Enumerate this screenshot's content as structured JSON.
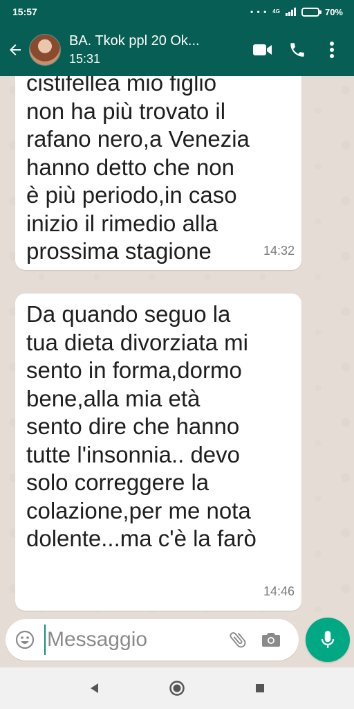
{
  "status_bar": {
    "time": "15:57",
    "dots": "• • •",
    "network": "4G",
    "battery_percent": "70%",
    "battery_level": 0.7
  },
  "header": {
    "contact_name": "BA. Tkok ppl 20 Ok...",
    "subtitle": "15:31",
    "icons": [
      "back-arrow-icon",
      "video-call-icon",
      "phone-icon",
      "more-vertical-icon"
    ]
  },
  "messages": [
    {
      "text": "cistifellea mio figlio\nnon ha più trovato il\nrafano nero,a Venezia\nhanno detto che non\nè  più periodo,in caso\ninizio il rimedio alla\nprossima stagione",
      "time": "14:32"
    },
    {
      "text": "Da quando seguo la\ntua dieta divorziata mi\nsento in forma,dormo\nbene,alla mia età\nsento dire che hanno\ntutte l'insonnia.. devo\nsolo correggere la\ncolazione,per me nota\ndolente...ma c'è la farò",
      "time": "14:46"
    }
  ],
  "composer": {
    "placeholder": "Messaggio",
    "value": ""
  },
  "colors": {
    "header": "#075e54",
    "accent": "#00a884",
    "chat_bg": "#e5ddd5",
    "bubble": "#ffffff"
  }
}
